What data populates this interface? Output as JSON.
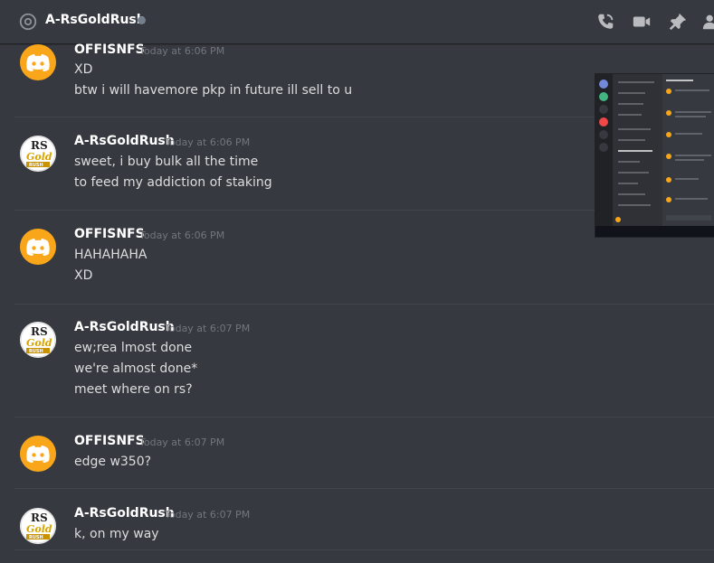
{
  "header": {
    "channel_title": "A-RsGoldRush"
  },
  "embedded_screenshot": {
    "description_label": "Embedded Discord screenshot"
  },
  "messages": [
    {
      "author": "OFFISNFS",
      "timestamp": "Today at 6:06 PM",
      "lines": [
        "XD",
        "btw i will havemore pkp in future ill sell to u"
      ]
    },
    {
      "author": "A-RsGoldRush",
      "timestamp": "Today at 6:06 PM",
      "lines": [
        "sweet, i buy bulk all the time",
        "to feed my addiction of staking"
      ]
    },
    {
      "author": "OFFISNFS",
      "timestamp": "Today at 6:06 PM",
      "lines": [
        "HAHAHAHA",
        "XD"
      ]
    },
    {
      "author": "A-RsGoldRush",
      "timestamp": "Today at 6:07 PM",
      "lines": [
        "ew;rea lmost done",
        "we're almost done*",
        "meet where on rs?"
      ]
    },
    {
      "author": "OFFISNFS",
      "timestamp": "Today at 6:07 PM",
      "lines": [
        "edge w350?"
      ]
    },
    {
      "author": "A-RsGoldRush",
      "timestamp": "Today at 6:07 PM",
      "lines": [
        "k, on my way"
      ]
    }
  ],
  "colors": {
    "background": "#36393f",
    "discord_avatar": "#faa61a",
    "username": "#ffffff",
    "timestamp": "#72767d",
    "text": "#dcddde"
  }
}
